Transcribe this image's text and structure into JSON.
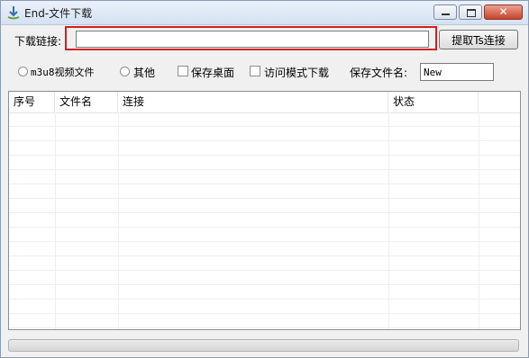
{
  "window": {
    "title": "End-文件下载"
  },
  "url_row": {
    "label": "下载链接:",
    "value": "",
    "extract_button": "提取Ts连接"
  },
  "options": {
    "radio_m3u8": "m3u8视频文件",
    "radio_other": "其他",
    "check_save_desktop": "保存桌面",
    "check_access_mode": "访问模式下载",
    "filename_label": "保存文件名:",
    "filename_value": "New"
  },
  "table": {
    "columns": [
      "序号",
      "文件名",
      "连接",
      "状态"
    ],
    "rows": []
  },
  "progress": {
    "value": 0
  },
  "colors": {
    "highlight": "#d11f1f",
    "titlebar": "#dbe6f4",
    "close_button": "#c7432a"
  }
}
